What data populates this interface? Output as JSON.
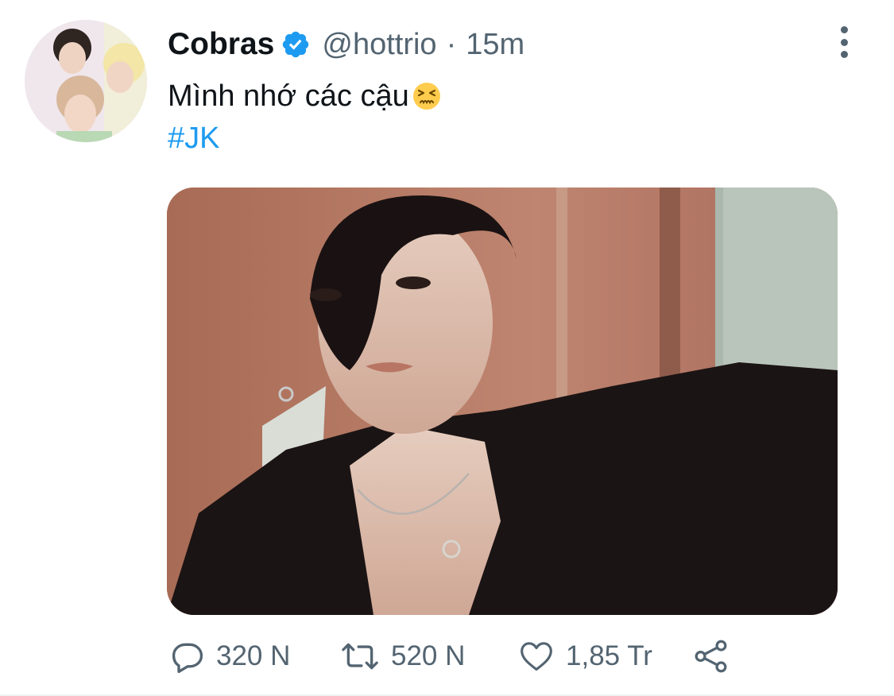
{
  "tweet": {
    "display_name": "Cobras",
    "handle": "@hottrio",
    "separator": "·",
    "time": "15m",
    "text": "Mình nhớ các cậu",
    "hashtag": "#JK"
  },
  "actions": {
    "reply_count": "320 N",
    "retweet_count": "520 N",
    "like_count": "1,85 Tr"
  },
  "icons": {
    "verified": "verified-badge-icon",
    "emoji": "persevering-face-emoji",
    "more": "more-vertical-icon",
    "reply": "reply-icon",
    "retweet": "retweet-icon",
    "like": "heart-icon",
    "share": "share-icon"
  },
  "colors": {
    "text": "#0f1419",
    "secondary": "#536471",
    "accent": "#1d9bf0"
  }
}
